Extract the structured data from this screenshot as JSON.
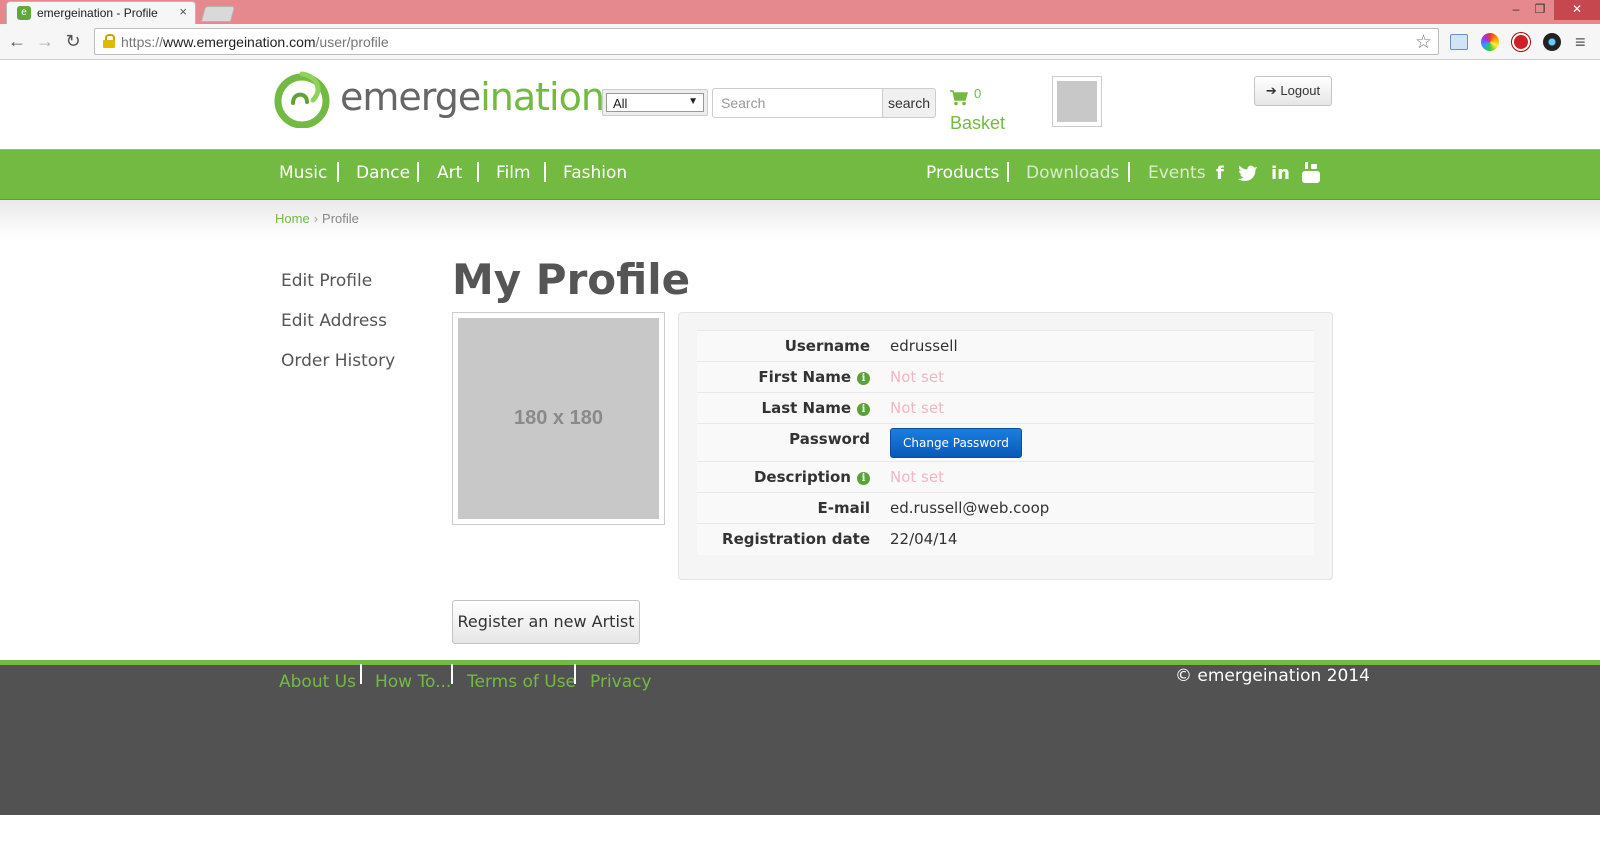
{
  "browser": {
    "tab_title": "emergeination - Profile",
    "tab_close": "×",
    "url_prefix": "https://",
    "url_host": "www.emergeination.com",
    "url_path": "/user/profile",
    "window_min": "–",
    "window_max": "❐",
    "window_close": "✕"
  },
  "header": {
    "logo_left": "emerge",
    "logo_right": "ination",
    "category_select_value": "All",
    "search_placeholder": "Search",
    "search_button": "search",
    "cart_count": "0",
    "basket_label": "Basket",
    "logout_label": "Logout"
  },
  "nav": {
    "left": [
      "Music",
      "Dance",
      "Art",
      "Film",
      "Fashion"
    ],
    "right": [
      "Products",
      "Downloads",
      "Events"
    ],
    "social_icons": [
      "facebook-icon",
      "twitter-icon",
      "linkedin-icon",
      "youtube-icon"
    ]
  },
  "breadcrumb": {
    "home": "Home",
    "separator": "›",
    "current": "Profile"
  },
  "sidebar": {
    "items": [
      "Edit Profile",
      "Edit Address",
      "Order History"
    ]
  },
  "profile": {
    "title": "My Profile",
    "avatar_placeholder": "180 x 180",
    "rows": [
      {
        "label": "Username",
        "value": "edrussell"
      },
      {
        "label": "First Name",
        "value": "Not set"
      },
      {
        "label": "Last Name",
        "value": "Not set"
      },
      {
        "label": "Password",
        "value": "Change Password"
      },
      {
        "label": "Description",
        "value": "Not set"
      },
      {
        "label": "E-mail",
        "value": "ed.russell@web.coop"
      },
      {
        "label": "Registration date",
        "value": "22/04/14"
      }
    ],
    "register_button": "Register an new Artist"
  },
  "footer": {
    "links": [
      "About Us",
      "How To...",
      "Terms of Use",
      "Privacy"
    ],
    "copyright": "© emergeination 2014"
  },
  "colors": {
    "brand_green": "#73ba43",
    "footer_bg": "#525253",
    "button_blue": "#0a59b8",
    "not_set_pink": "#f3b6c3",
    "titlebar": "#e5898e"
  }
}
